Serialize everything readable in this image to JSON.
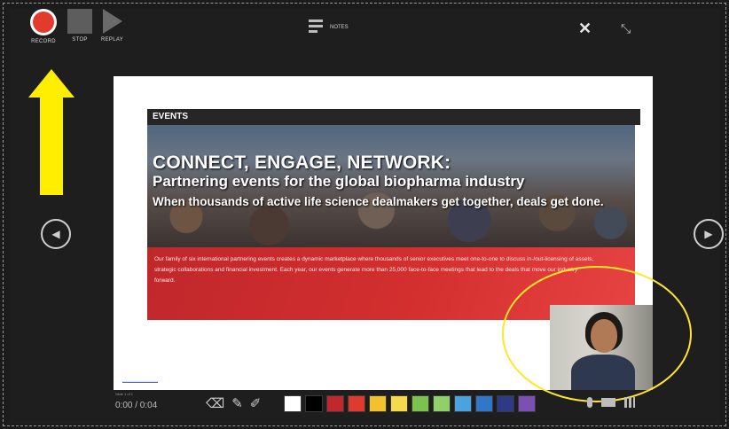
{
  "toolbar": {
    "record_label": "RECORD",
    "stop_label": "STOP",
    "replay_label": "REPLAY",
    "notes_label": "NOTES"
  },
  "slide": {
    "banner": "EVENTS",
    "headline": "CONNECT, ENGAGE, NETWORK:",
    "subheadline": "Partnering events for the global biopharma industry",
    "tagline": "When thousands of active life science dealmakers get together, deals get done.",
    "body": "Our family of six international partnering events creates a dynamic marketplace where thousands of senior executives meet one-to-one to discuss in-/out-licensing of assets, strategic collaborations and financial investment. Each year, our events generate more than 25,000 face-to-face meetings that lead to the deals that move our industry forward."
  },
  "footer": {
    "slide_count": "Slide 1 of 1",
    "timer": "0:00 / 0:04"
  },
  "colors": {
    "ink_swatches": [
      "#ffffff",
      "#000000",
      "#c0282d",
      "#e03a2f",
      "#f2c12e",
      "#f7d94c",
      "#7cc24e",
      "#8fd06a",
      "#4aa3df",
      "#2f77c9",
      "#2d3a86",
      "#7c4fb3"
    ],
    "record_red": "#e23a2c",
    "highlight_yellow": "#ffee00"
  },
  "icons": {
    "prev": "chevron-left-icon",
    "next": "chevron-right-icon",
    "close": "close-icon",
    "shrink": "shrink-icon",
    "notes": "notes-icon",
    "eraser": "eraser-icon",
    "pen": "pen-icon",
    "highlighter": "highlighter-icon",
    "mic": "microphone-icon",
    "camera": "camera-icon",
    "camera_preview": "camera-preview-icon"
  }
}
